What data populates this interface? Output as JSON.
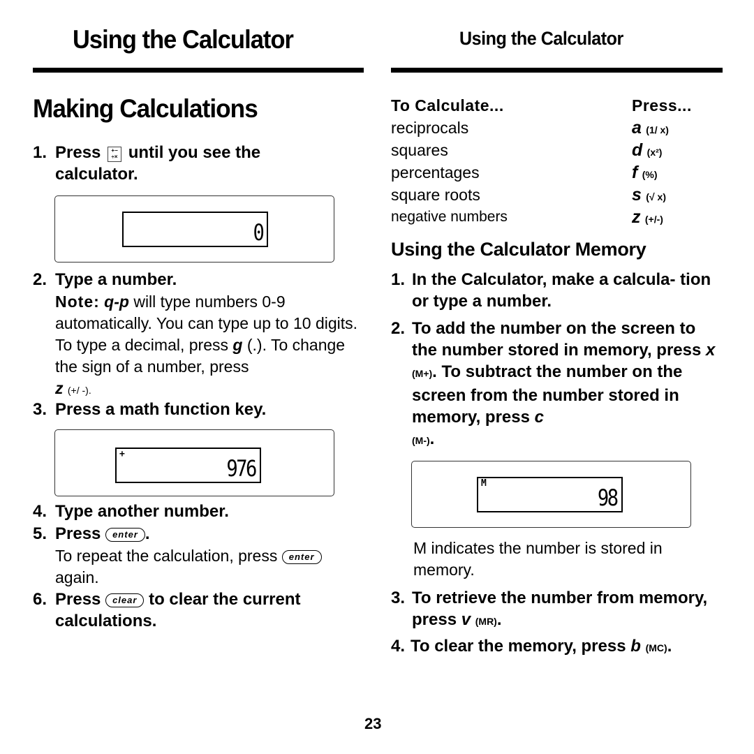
{
  "header": {
    "left_title": "Using the Calculator",
    "right_title": "Using the Calculator"
  },
  "left": {
    "section_title": "Making Calculations",
    "steps": [
      {
        "num": "1.",
        "pre": "Press",
        "icon": "calculator-key-icon",
        "post": "until you see the calculator."
      },
      {
        "num": "2.",
        "text": "Type a number."
      },
      {
        "num": "3.",
        "text": "Press a math function key."
      },
      {
        "num": "4.",
        "text": "Type another number."
      },
      {
        "num": "5.",
        "pre": "Press",
        "key": "enter",
        "post": "."
      },
      {
        "num": "6.",
        "pre": "Press",
        "key": "clear",
        "post": "to clear the current calculations."
      }
    ],
    "calc_icon_glyphs": [
      "+",
      "−",
      "÷",
      "×"
    ],
    "note": {
      "label": "Note:",
      "keys": "q-p",
      "text1": "will type numbers 0-9 automatically. You can type up to 10 digits. To type a decimal, press",
      "decimal_key": "g",
      "decimal_paren": "(.).",
      "text2": "To change the sign of a number, press",
      "sign_key": "z",
      "sign_paren": "(+/ -)."
    },
    "repeat": {
      "text1": "To repeat the calculation, press",
      "key": "enter",
      "text2": "again."
    },
    "display1": {
      "indicator": "",
      "value": "0"
    },
    "display2": {
      "indicator": "+",
      "value": "976"
    }
  },
  "right": {
    "table": {
      "col1_header": "To Calculate...",
      "col2_header": "Press...",
      "rows": [
        {
          "item": "reciprocals",
          "key": "a",
          "func": "(1/ x)"
        },
        {
          "item": "squares",
          "key": "d",
          "func": "(x²)"
        },
        {
          "item": "percentages",
          "key": "f",
          "func": "(%)"
        },
        {
          "item": "square roots",
          "key": "s",
          "func": "(√  x)"
        },
        {
          "item": "negative numbers",
          "key": "z",
          "func": "(+/-)"
        }
      ]
    },
    "memory_title": "Using the Calculator Memory",
    "steps": [
      {
        "num": "1.",
        "text": "In the Calculator, make a calcula- tion or type a number."
      },
      {
        "num": "2.",
        "text1": "To add the number on the screen to the number stored in memory, press",
        "key1": "x",
        "paren1": "(M+)",
        "text2": ". To subtract the number on the screen from the number stored in memory, press",
        "key2": "c",
        "paren2": "(M-)",
        "end": "."
      },
      {
        "num": "3.",
        "text": "To retrieve the number from memory, press",
        "key": "v",
        "paren": "(MR)",
        "end": "."
      },
      {
        "num": "4.",
        "text": "To clear the memory, press",
        "key": "b",
        "paren": "(MC)",
        "end": "."
      }
    ],
    "display3": {
      "indicator": "M",
      "value": "98"
    },
    "m_note": "M indicates the number is stored in memory."
  },
  "footer": {
    "page_number": "23"
  }
}
